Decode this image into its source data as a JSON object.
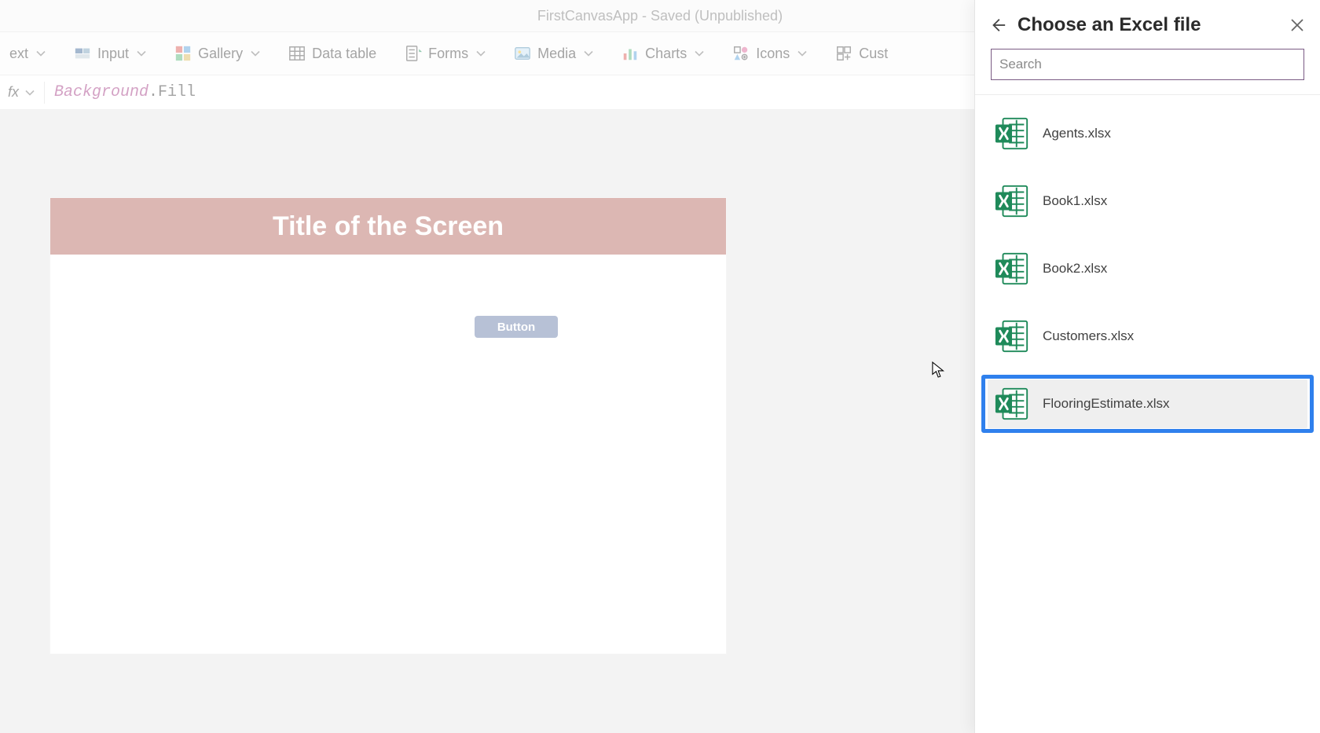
{
  "title_bar": "FirstCanvasApp - Saved (Unpublished)",
  "ribbon": {
    "text": "ext",
    "input": "Input",
    "gallery": "Gallery",
    "data_table": "Data table",
    "forms": "Forms",
    "media": "Media",
    "charts": "Charts",
    "icons": "Icons",
    "custom": "Cust"
  },
  "formula": {
    "fx_label": "fx",
    "token_object": "Background",
    "token_prop": ".Fill"
  },
  "canvas": {
    "screen_title": "Title of the Screen",
    "button_label": "Button"
  },
  "panel": {
    "title": "Choose an Excel file",
    "search_placeholder": "Search",
    "files": [
      {
        "name": "Agents.xlsx"
      },
      {
        "name": "Book1.xlsx"
      },
      {
        "name": "Book2.xlsx"
      },
      {
        "name": "Customers.xlsx"
      },
      {
        "name": "FlooringEstimate.xlsx"
      }
    ],
    "selected_index": 4
  }
}
